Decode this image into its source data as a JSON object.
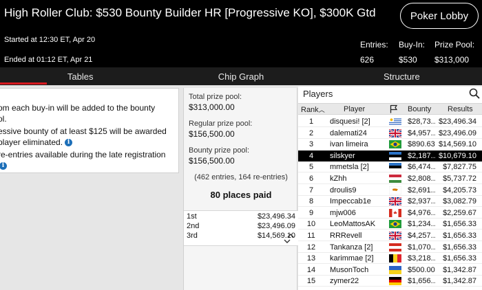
{
  "header": {
    "title": "High Roller Club: $530 Bounty Builder HR [Progressive KO], $300K Gtd",
    "lobby_button": "Poker Lobby",
    "started": "Started at 12:30 ET, Apr 20",
    "ended": "Ended at 01:12 ET, Apr 21",
    "stats": {
      "entries_label": "Entries:",
      "entries_value": "626",
      "buyin_label": "Buy-In:",
      "buyin_value": "$530",
      "prize_label": "Prize Pool:",
      "prize_value": "$313,000"
    }
  },
  "tabs": [
    "Tables",
    "Chip Graph",
    "Structure"
  ],
  "info": {
    "lines": [
      "om each buy-in will be added to the bounty",
      "ol.",
      "essive bounty of at least $125 will be awarded",
      "player eliminated.",
      "re-entries available during the late registration"
    ],
    "icon_glyph": "i"
  },
  "prize": {
    "total_label": "Total prize pool:",
    "total_value": "$313,000.00",
    "regular_label": "Regular prize pool:",
    "regular_value": "$156,500.00",
    "bounty_label": "Bounty prize pool:",
    "bounty_value": "$156,500.00",
    "entries_note": "(462 entries, 164 re-entries)",
    "places_paid": "80 places paid",
    "payouts": [
      {
        "place": "1st",
        "amount": "$23,496.34"
      },
      {
        "place": "2nd",
        "amount": "$23,496.09"
      },
      {
        "place": "3rd",
        "amount": "$14,569.10"
      }
    ]
  },
  "players": {
    "title": "Players",
    "headers": {
      "rank": "Rank",
      "player": "Player",
      "bounty": "Bounty",
      "results": "Results"
    },
    "rows": [
      {
        "rank": "1",
        "name": "disquesi! [2]",
        "flag": "uruguay",
        "bounty": "$28,73...",
        "result": "$23,496.34"
      },
      {
        "rank": "2",
        "name": "dalemati24",
        "flag": "uk",
        "bounty": "$4,957...",
        "result": "$23,496.09"
      },
      {
        "rank": "3",
        "name": "ivan limeira",
        "flag": "brazil",
        "bounty": "$890.63",
        "result": "$14,569.10"
      },
      {
        "rank": "4",
        "name": "silskyer",
        "flag": "estonia",
        "bounty": "$2,187...",
        "result": "$10,679.10"
      },
      {
        "rank": "5",
        "name": "mmetsla [2]",
        "flag": "estonia",
        "bounty": "$6,474...",
        "result": "$7,827.75"
      },
      {
        "rank": "6",
        "name": "kZhh",
        "flag": "hungary",
        "bounty": "$2,808...",
        "result": "$5,737.72"
      },
      {
        "rank": "7",
        "name": "droulis9",
        "flag": "cyprus",
        "bounty": "$2,691...",
        "result": "$4,205.73"
      },
      {
        "rank": "8",
        "name": "Impeccab1e",
        "flag": "uk",
        "bounty": "$2,937...",
        "result": "$3,082.79"
      },
      {
        "rank": "9",
        "name": "mjw006",
        "flag": "canada",
        "bounty": "$4,976...",
        "result": "$2,259.67"
      },
      {
        "rank": "10",
        "name": "LeoMattosAK",
        "flag": "brazil",
        "bounty": "$1,234...",
        "result": "$1,656.33"
      },
      {
        "rank": "11",
        "name": "RRRevell",
        "flag": "uk",
        "bounty": "$4,257...",
        "result": "$1,656.33"
      },
      {
        "rank": "12",
        "name": "Tankanza [2]",
        "flag": "austria",
        "bounty": "$1,070...",
        "result": "$1,656.33"
      },
      {
        "rank": "13",
        "name": "karimmae [2]",
        "flag": "belgium",
        "bounty": "$3,218...",
        "result": "$1,656.33"
      },
      {
        "rank": "14",
        "name": "MusonToch",
        "flag": "ukraine",
        "bounty": "$500.00",
        "result": "$1,342.87"
      },
      {
        "rank": "15",
        "name": "zymer22",
        "flag": "germany",
        "bounty": "$1,656...",
        "result": "$1,342.87"
      }
    ]
  },
  "colors": {
    "accent": "#d71920",
    "selected_row": "#000000",
    "header_bg": "#000000",
    "tab_bg": "#1c1c1c"
  }
}
